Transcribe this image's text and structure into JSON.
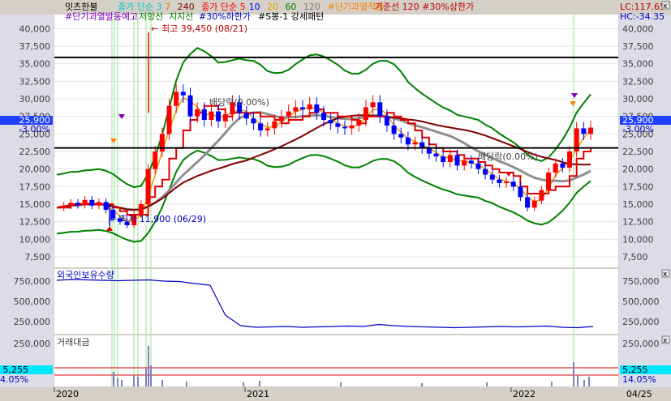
{
  "header": {
    "name": "잇츠한불",
    "items": [
      {
        "text": "종가 단순 3",
        "color": "#00c8c8"
      },
      {
        "text": "7",
        "color": "#d08000"
      },
      {
        "text": "240",
        "color": "#800000"
      },
      {
        "text": "종가 단순 5",
        "color": "#ff0000"
      },
      {
        "text": "10",
        "color": "#0000ff"
      },
      {
        "text": "20",
        "color": "#e0a000"
      },
      {
        "text": "60",
        "color": "#008000"
      },
      {
        "text": "120",
        "color": "#808080"
      },
      {
        "text": "#단기과열적출",
        "color": "#ff8000"
      },
      {
        "text": "기준선 120",
        "color": "#c00000"
      },
      {
        "text": "#30%상한가",
        "color": "#c00000"
      }
    ],
    "line2": [
      {
        "text": "#단기과열발동예고",
        "color": "#8000c0"
      },
      {
        "text": "저항선",
        "color": "#008000"
      },
      {
        "text": "지지선",
        "color": "#008000"
      },
      {
        "text": "#30%하한가",
        "color": "#0000c0"
      },
      {
        "text": "#S봉-1 강세패턴",
        "color": "#000000"
      }
    ],
    "lc": "LC:117.65",
    "hc": "HC:-34.35"
  },
  "annotations": {
    "max_label": "최고 39,450 (08/21)",
    "min_label": "최저 11,900 (06/29)",
    "dividend1": "배당락(0.00%)",
    "dividend2": "배당락(0.00%)"
  },
  "price_tag": {
    "price": "25,900",
    "change": "-3.00%"
  },
  "volume_tag": {
    "value": "5,255",
    "pct": "14.05%"
  },
  "panel_titles": {
    "foreign": "외국인보유수량",
    "trade": "거래대금"
  },
  "colors": {
    "price_up": "#ff0000",
    "price_down": "#0000ff",
    "bollinger": "#008000",
    "ma120": "#808080",
    "ma240": "#800000",
    "base_line": "#e00000",
    "foreign": "#0000c0"
  },
  "chart_data": {
    "type": "candlestick",
    "x_axis": {
      "labels": [
        "2020",
        "2021",
        "2022",
        "04/25"
      ],
      "positions_date": [
        "2020-01",
        "2021-01",
        "2022-01",
        "2022-04-25"
      ]
    },
    "price": {
      "y_ticks": [
        "40,000",
        "37,500",
        "35,000",
        "32,500",
        "30,000",
        "27,500",
        "25,000",
        "22,500",
        "20,000",
        "17,500",
        "15,000",
        "12,500",
        "10,000",
        "7,500"
      ],
      "ylim": [
        6000,
        42000
      ],
      "horizontal_lines": [
        35900,
        23000
      ],
      "close_series": [
        14500,
        14800,
        15200,
        14900,
        15600,
        14800,
        15300,
        14200,
        13000,
        12500,
        12000,
        13500,
        15000,
        20000,
        22500,
        25000,
        29000,
        31000,
        30500,
        27500,
        28500,
        27000,
        28200,
        26800,
        27800,
        29500,
        28000,
        27200,
        26500,
        25500,
        25800,
        26800,
        27500,
        28200,
        28800,
        28500,
        29200,
        28000,
        27000,
        26500,
        26000,
        25800,
        26200,
        27000,
        28800,
        29500,
        27500,
        26200,
        25000,
        24500,
        23500,
        23800,
        23000,
        22200,
        21800,
        21000,
        22000,
        20500,
        21200,
        20800,
        20000,
        19200,
        18500,
        18000,
        18200,
        17500,
        16000,
        14500,
        15500,
        17000,
        19500,
        20800,
        20200,
        22500,
        25800,
        25000,
        25900
      ],
      "max": {
        "value": 39450,
        "date": "08/21"
      },
      "min": {
        "value": 11900,
        "date": "06/29"
      }
    },
    "foreign_holdings": {
      "y_ticks": [
        "750,000",
        "500,000",
        "250,000"
      ],
      "ylim": [
        100000,
        900000
      ],
      "values": [
        760000,
        770000,
        765000,
        760000,
        755000,
        760000,
        765000,
        750000,
        745000,
        720000,
        700000,
        330000,
        200000,
        180000,
        185000,
        190000,
        180000,
        185000,
        190000,
        195000,
        190000,
        215000,
        200000,
        190000,
        185000,
        180000,
        175000,
        180000,
        185000,
        190000,
        185000,
        190000,
        195000,
        180000,
        175000,
        190000
      ]
    },
    "trade_value": {
      "y_ticks": [
        "250,000"
      ],
      "ylim": [
        0,
        300000
      ],
      "title": "거래대금"
    }
  }
}
